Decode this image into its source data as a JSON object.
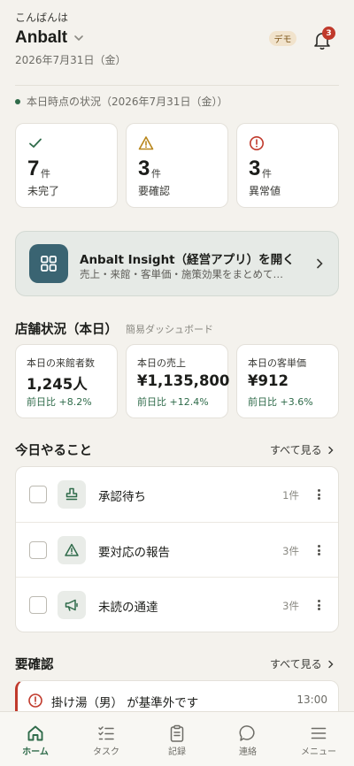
{
  "header": {
    "greeting": "こんばんは",
    "store_name": "Anbalt",
    "date": "2026年7月31日（金）",
    "demo_badge": "デモ",
    "notification_count": "3"
  },
  "status_line": "本日時点の状況（2026年7月31日（金））",
  "stats": [
    {
      "value": "7",
      "unit": "件",
      "label": "未完了",
      "icon": "check-icon",
      "color": "#2f6b4a"
    },
    {
      "value": "3",
      "unit": "件",
      "label": "要確認",
      "icon": "warning-icon",
      "color": "#b8861b"
    },
    {
      "value": "3",
      "unit": "件",
      "label": "異常値",
      "icon": "alert-circle-icon",
      "color": "#c0392b"
    }
  ],
  "insight": {
    "title": "Anbalt Insight（経営アプリ）を開く",
    "subtitle": "売上・来館・客単価・施策効果をまとめて…",
    "icon": "grid-icon"
  },
  "store_status": {
    "title": "店舗状況（本日）",
    "subtitle": "簡易ダッシュボード",
    "kpis": [
      {
        "label": "本日の来館者数",
        "value": "1,245人",
        "delta": "前日比 +8.2%"
      },
      {
        "label": "本日の売上",
        "value": "¥1,135,800",
        "delta": "前日比 +12.4%"
      },
      {
        "label": "本日の客単価",
        "value": "¥912",
        "delta": "前日比 +3.6%"
      }
    ]
  },
  "todo": {
    "title": "今日やること",
    "see_all": "すべて見る",
    "items": [
      {
        "label": "承認待ち",
        "count": "1件",
        "icon": "stamp-icon"
      },
      {
        "label": "要対応の報告",
        "count": "3件",
        "icon": "warning-icon"
      },
      {
        "label": "未読の通達",
        "count": "3件",
        "icon": "megaphone-icon"
      }
    ]
  },
  "review": {
    "title": "要確認",
    "see_all": "すべて見る",
    "items": [
      {
        "text": "掛け湯（男） が基準外です",
        "time": "13:00",
        "icon": "alert-circle-icon"
      }
    ]
  },
  "bottom_nav": [
    {
      "label": "ホーム",
      "icon": "home-icon",
      "active": true
    },
    {
      "label": "タスク",
      "icon": "task-list-icon",
      "active": false
    },
    {
      "label": "記録",
      "icon": "clipboard-icon",
      "active": false
    },
    {
      "label": "連絡",
      "icon": "chat-icon",
      "active": false
    },
    {
      "label": "メニュー",
      "icon": "menu-icon",
      "active": false
    }
  ],
  "colors": {
    "background": "#f4f2ed",
    "accent_green": "#2f6b4a",
    "insight_teal": "#3a6472",
    "alert_red": "#c0392b"
  }
}
